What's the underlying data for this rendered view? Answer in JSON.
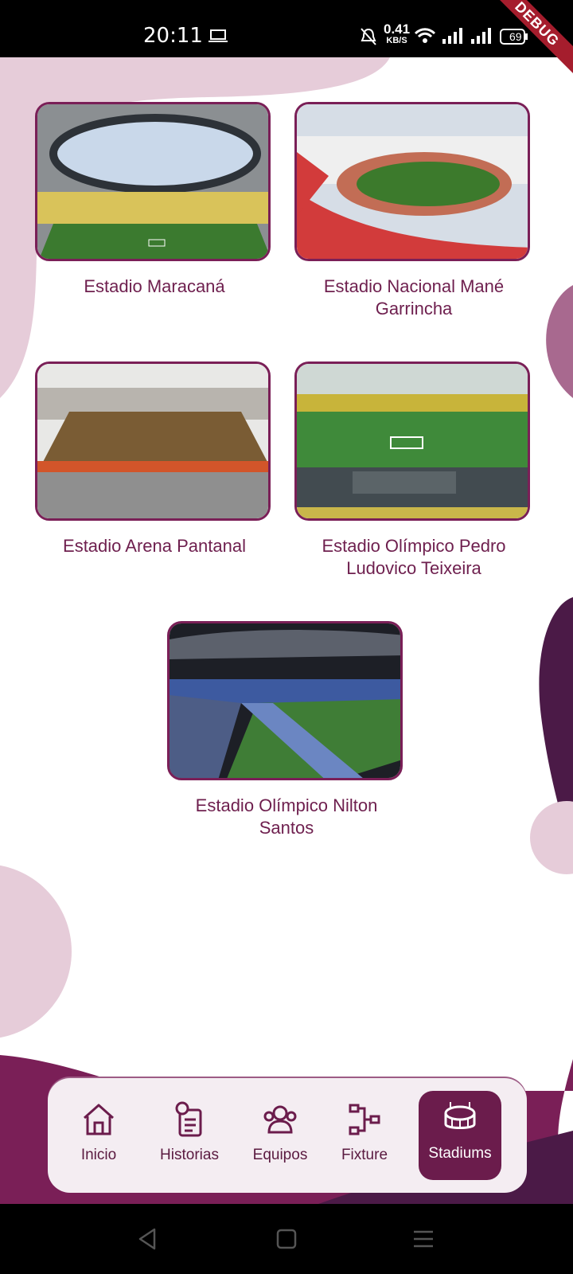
{
  "status_bar": {
    "time": "20:11",
    "net_speed_value": "0.41",
    "net_speed_unit": "KB/S",
    "battery": "69",
    "debug_banner": "DEBUG"
  },
  "stadiums": [
    {
      "name": "Estadio Maracaná"
    },
    {
      "name": "Estadio Nacional Mané Garrincha"
    },
    {
      "name": "Estadio Arena Pantanal"
    },
    {
      "name": "Estadio Olímpico Pedro Ludovico Teixeira"
    },
    {
      "name": "Estadio Olímpico Nilton Santos"
    }
  ],
  "bottom_nav": {
    "items": [
      {
        "label": "Inicio",
        "icon": "home-icon"
      },
      {
        "label": "Historias",
        "icon": "history-icon"
      },
      {
        "label": "Equipos",
        "icon": "teams-icon"
      },
      {
        "label": "Fixture",
        "icon": "bracket-icon"
      },
      {
        "label": "Stadiums",
        "icon": "stadium-icon",
        "active": true
      }
    ]
  },
  "colors": {
    "accent": "#6b1c4c",
    "text": "#6e1f4e",
    "blob_light": "#e6ccd9"
  }
}
